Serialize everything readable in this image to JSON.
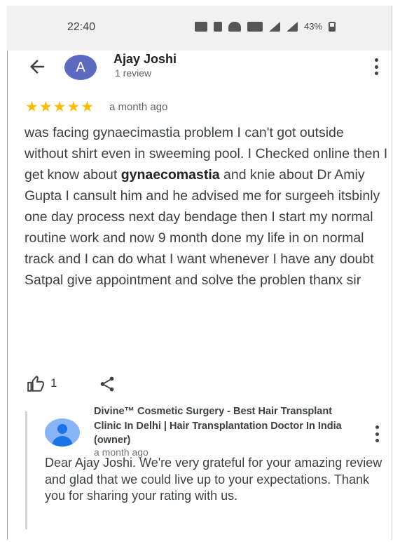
{
  "status_bar": {
    "time": "22:40",
    "battery": "43%"
  },
  "reviewer": {
    "avatar_letter": "A",
    "name": "Ajay Joshi",
    "review_count": "1 review"
  },
  "review": {
    "rating": 5,
    "stars": "★★★★★",
    "date": "a month ago",
    "text_before": "was facing gynaecimastia problem I can't got outside without shirt even in sweeming pool. I Checked online then I get know about ",
    "text_bold": "gynaecomastia",
    "text_after": " and knie about Dr Amiy Gupta I cansult him and he advised me for surgeeh itsbinly one day process next day bendage then I start my normal routine work and now 9 month done my life in on normal track and I can do what I want whenever I have any doubt Satpal give appointment and solve the problen thanx sir",
    "like_count": "1"
  },
  "owner_response": {
    "name": "Divine™ Cosmetic Surgery - Best Hair Transplant Clinic In Delhi | Hair Transplantation Doctor In India (owner)",
    "date": "a month ago",
    "text": "Dear Ajay Joshi. We're very grateful for your amazing review and glad that we could live up to your expectations. Thank you for sharing your rating with us."
  },
  "icons": [
    "back-arrow-icon",
    "more-options-icon",
    "thumbs-up-icon",
    "share-icon",
    "owner-avatar-icon"
  ],
  "colors": {
    "star": "#fbbc04",
    "avatar": "#5c6bc0",
    "owner_avatar": "#1a73e8"
  }
}
